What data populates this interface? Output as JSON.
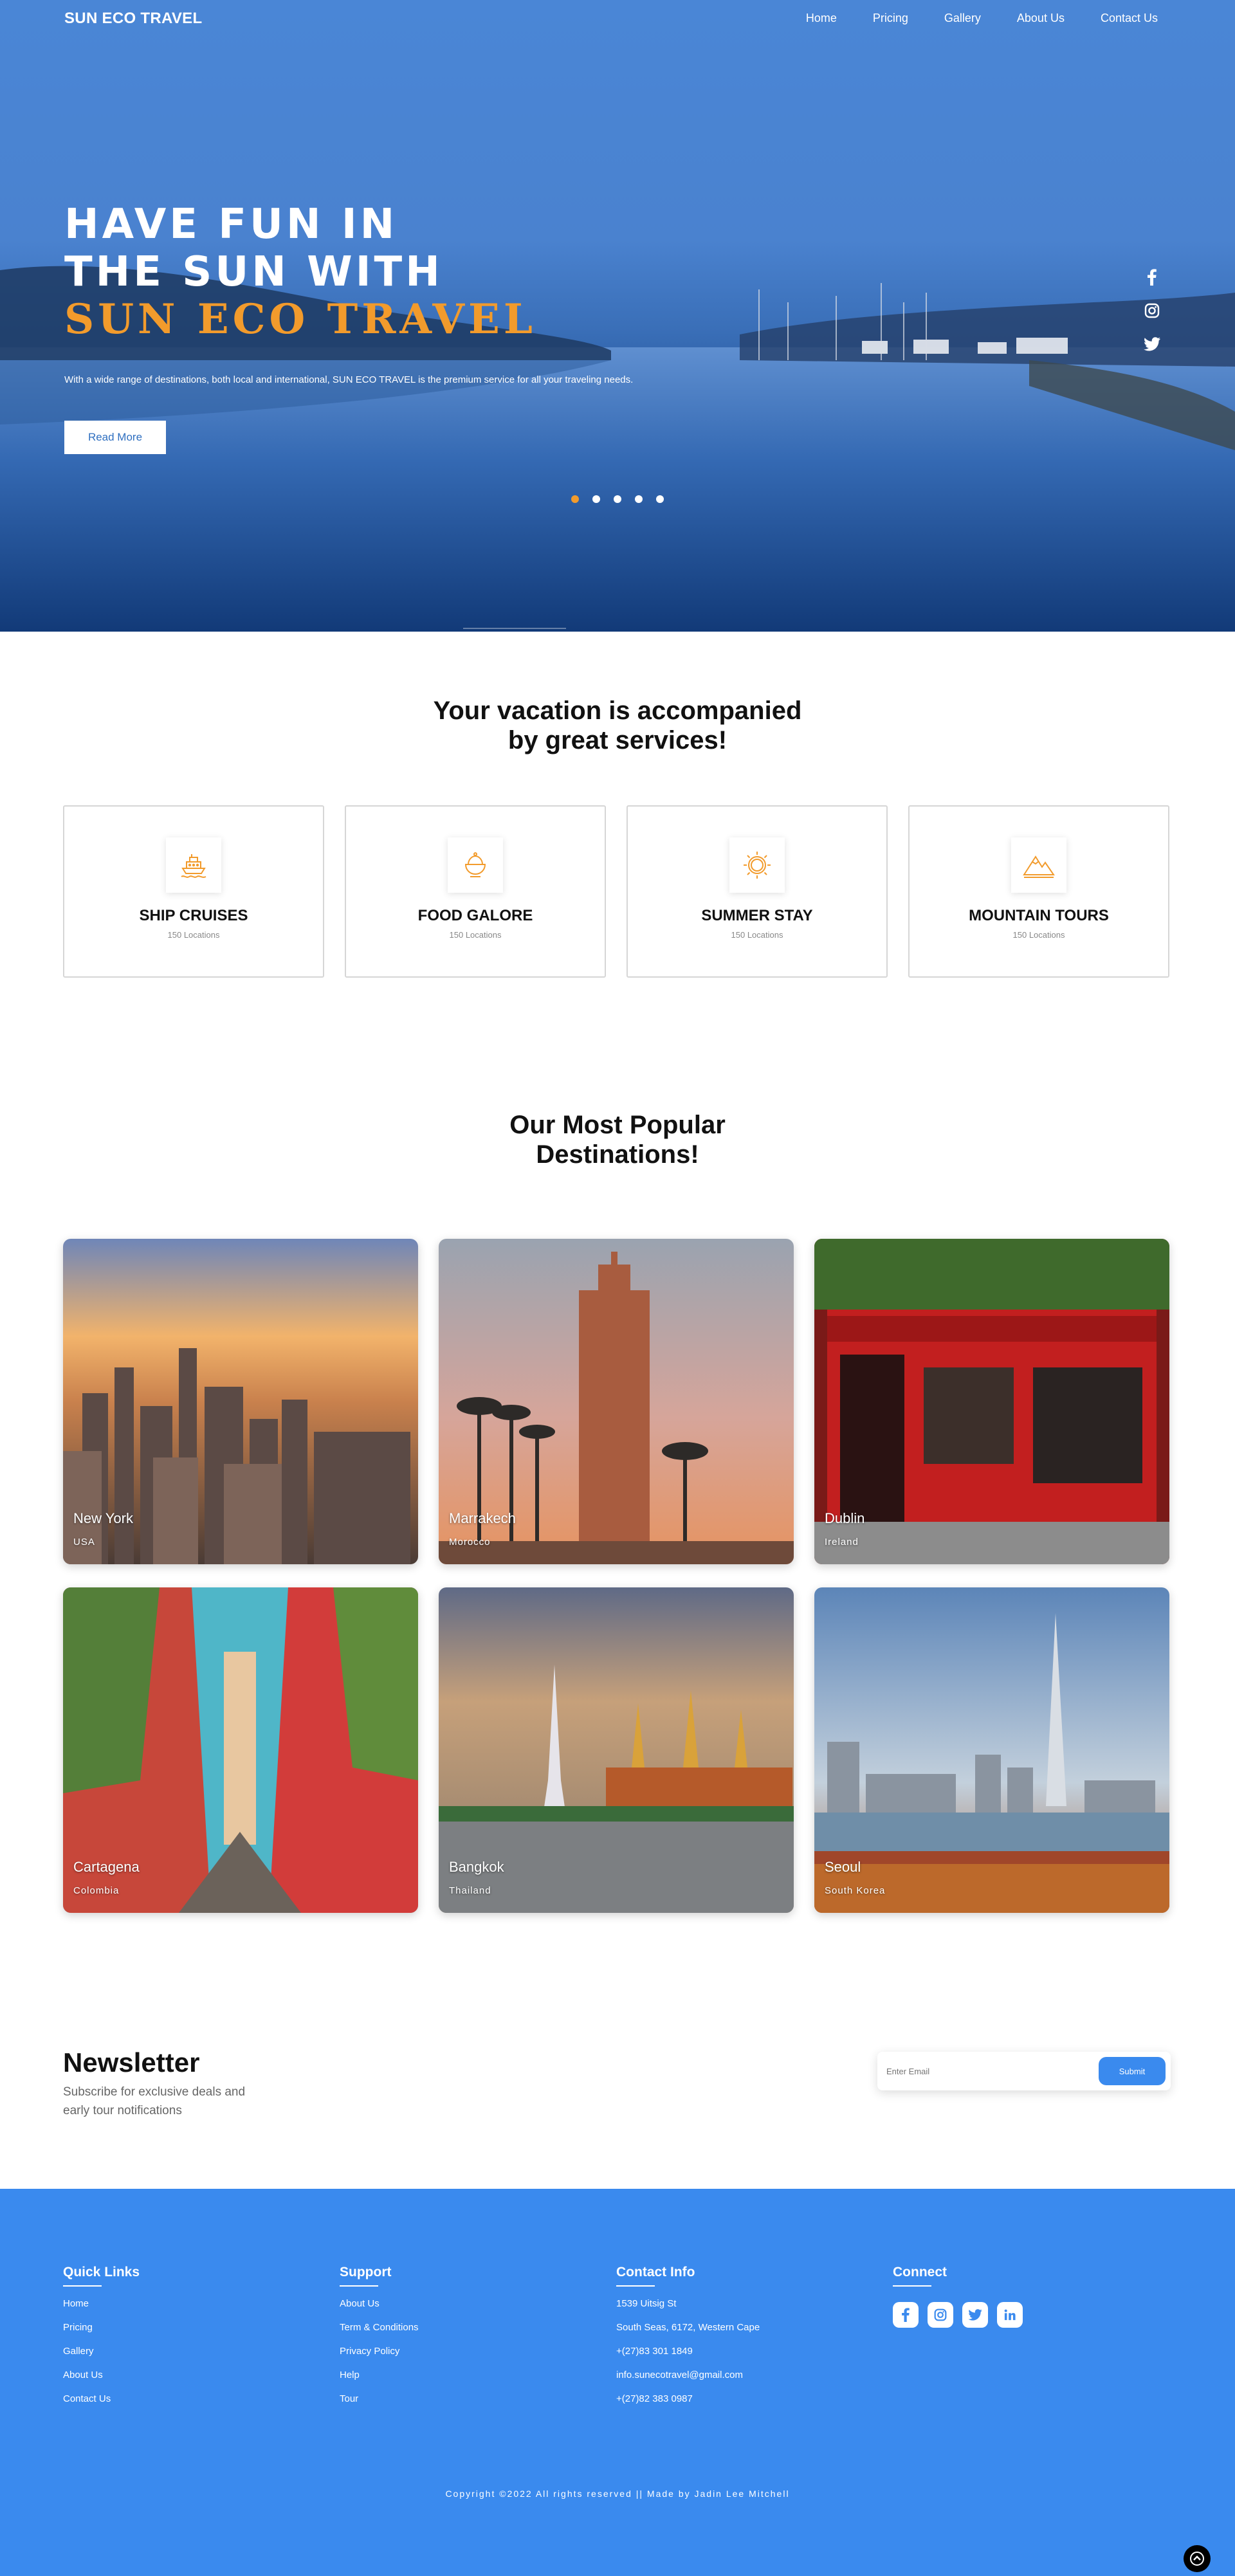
{
  "nav": {
    "brand": "SUN ECO TRAVEL",
    "links": [
      "Home",
      "Pricing",
      "Gallery",
      "About Us",
      "Contact Us"
    ]
  },
  "hero": {
    "title_line1": "HAVE FUN IN",
    "title_line2": "THE SUN WITH",
    "title_accent": "SUN ECO TRAVEL",
    "subtitle": "With a wide range of destinations, both local and international, SUN ECO TRAVEL is the premium service for all your traveling needs.",
    "button_label": "Read More",
    "slider_dots": 5,
    "active_dot": 1,
    "side_social_icons": [
      "facebook-icon",
      "instagram-icon",
      "twitter-icon"
    ]
  },
  "services": {
    "title_line1": "Your vacation is accompanied",
    "title_line2": "by great services!",
    "cards": [
      {
        "title": "SHIP CRUISES",
        "sub": "150 Locations",
        "icon": "ship-icon"
      },
      {
        "title": "FOOD GALORE",
        "sub": "150 Locations",
        "icon": "food-bowl-icon"
      },
      {
        "title": "SUMMER STAY",
        "sub": "150 Locations",
        "icon": "sun-icon"
      },
      {
        "title": "MOUNTAIN TOURS",
        "sub": "150 Locations",
        "icon": "mountain-icon"
      }
    ]
  },
  "destinations": {
    "title_line1": "Our Most Popular",
    "title_line2": "Destinations!",
    "items": [
      {
        "city": "New York",
        "country": "USA"
      },
      {
        "city": "Marrakech",
        "country": "Morocco"
      },
      {
        "city": "Dublin",
        "country": "Ireland"
      },
      {
        "city": "Cartagena",
        "country": "Colombia"
      },
      {
        "city": "Bangkok",
        "country": "Thailand"
      },
      {
        "city": "Seoul",
        "country": "South Korea"
      }
    ]
  },
  "newsletter": {
    "title": "Newsletter",
    "subtitle": "Subscribe for exclusive deals and early tour notifications",
    "placeholder": "Enter Email",
    "button_label": "Submit"
  },
  "footer": {
    "quick_links": {
      "heading": "Quick Links",
      "items": [
        "Home",
        "Pricing",
        "Gallery",
        "About Us",
        "Contact Us"
      ]
    },
    "support": {
      "heading": "Support",
      "items": [
        "About Us",
        "Term & Conditions",
        "Privacy Policy",
        "Help",
        "Tour"
      ]
    },
    "contact": {
      "heading": "Contact Info",
      "items": [
        "1539 Uitsig St",
        "South Seas, 6172, Western Cape",
        "+(27)83 301 1849",
        "info.sunecotravel@gmail.com",
        "+(27)82 383 0987"
      ]
    },
    "connect": {
      "heading": "Connect",
      "icons": [
        "facebook-icon",
        "instagram-icon",
        "twitter-icon",
        "linkedin-icon"
      ]
    },
    "copyright": "Copyright ©2022 All rights reserved || Made by Jadin Lee Mitchell"
  },
  "colors": {
    "accent_orange": "#f29b2c",
    "primary_blue": "#3a8aee"
  }
}
